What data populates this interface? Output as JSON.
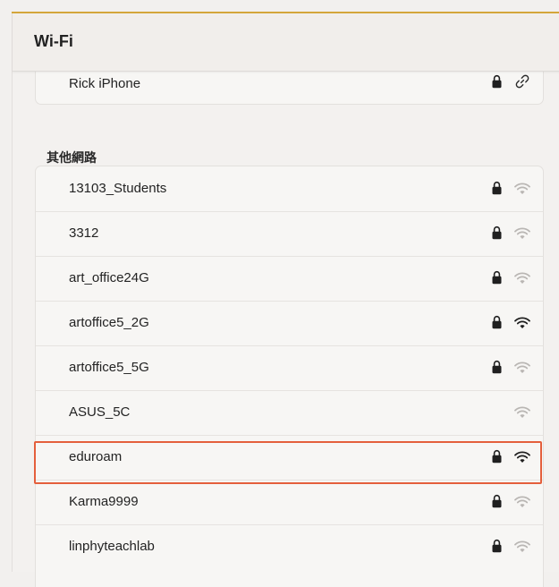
{
  "header": {
    "title": "Wi-Fi"
  },
  "known_networks": [
    {
      "name": "Rick iPhone",
      "locked": true,
      "hotspot": true
    }
  ],
  "other_section_label": "其他網路",
  "other_networks": [
    {
      "name": "13103_Students",
      "locked": true,
      "signal": "weak"
    },
    {
      "name": "3312",
      "locked": true,
      "signal": "weak"
    },
    {
      "name": "art_office24G",
      "locked": true,
      "signal": "weak"
    },
    {
      "name": "artoffice5_2G",
      "locked": true,
      "signal": "strong"
    },
    {
      "name": "artoffice5_5G",
      "locked": true,
      "signal": "weak"
    },
    {
      "name": "ASUS_5C",
      "locked": false,
      "signal": "weak"
    },
    {
      "name": "eduroam",
      "locked": true,
      "signal": "strong",
      "highlighted": true
    },
    {
      "name": "Karma9999",
      "locked": true,
      "signal": "weak"
    },
    {
      "name": "linphyteachlab",
      "locked": true,
      "signal": "weak"
    }
  ],
  "colors": {
    "highlight": "#e45f3c",
    "accent": "#d4a63a"
  }
}
